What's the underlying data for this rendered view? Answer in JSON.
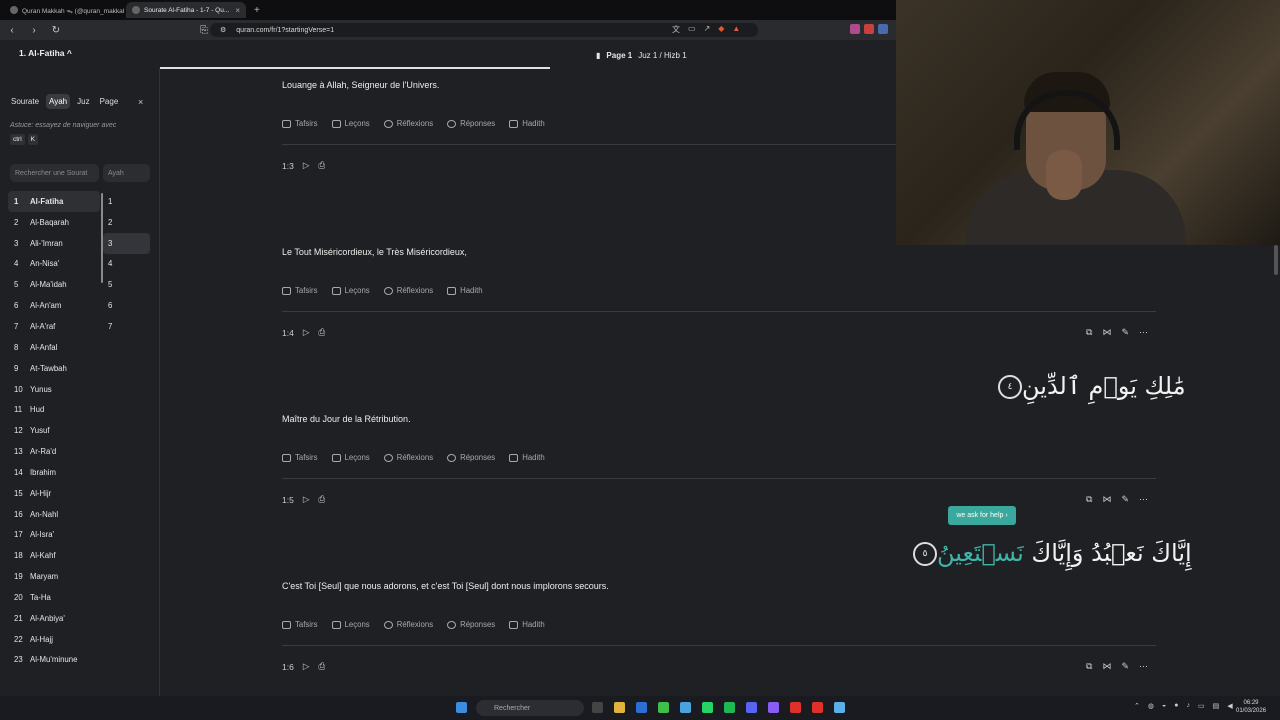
{
  "browser": {
    "tabs": [
      {
        "label": "Quran Makkah ᯓ (@quran_makkah...",
        "active": false
      },
      {
        "label": "Sourate Al-Fatiha - 1-7 - Qu...",
        "active": true
      }
    ],
    "new_tab": "+",
    "url": "quran.com/fr/1?startingVerse=1"
  },
  "header": {
    "surah_title": "1. Al-Fatiha ^",
    "page_label": "Page 1",
    "juz_label": "Juz 1 / Hizb 1"
  },
  "sidebar": {
    "tabs": [
      "Sourate",
      "Ayah",
      "Juz",
      "Page"
    ],
    "active_tab": "Ayah",
    "close": "×",
    "tip": "Astuce: essayez de naviguer avec",
    "kbd": [
      "ctrl",
      "K"
    ],
    "search_surah_placeholder": "Rechercher une Sourat",
    "search_ayah_placeholder": "Ayah",
    "surahs": [
      {
        "n": "1",
        "name": "Al-Fatiha"
      },
      {
        "n": "2",
        "name": "Al-Baqarah"
      },
      {
        "n": "3",
        "name": "Ali-'Imran"
      },
      {
        "n": "4",
        "name": "An-Nisa'"
      },
      {
        "n": "5",
        "name": "Al-Ma'idah"
      },
      {
        "n": "6",
        "name": "Al-An'am"
      },
      {
        "n": "7",
        "name": "Al-A'raf"
      },
      {
        "n": "8",
        "name": "Al-Anfal"
      },
      {
        "n": "9",
        "name": "At-Tawbah"
      },
      {
        "n": "10",
        "name": "Yunus"
      },
      {
        "n": "11",
        "name": "Hud"
      },
      {
        "n": "12",
        "name": "Yusuf"
      },
      {
        "n": "13",
        "name": "Ar-Ra'd"
      },
      {
        "n": "14",
        "name": "Ibrahim"
      },
      {
        "n": "15",
        "name": "Al-Hijr"
      },
      {
        "n": "16",
        "name": "An-Nahl"
      },
      {
        "n": "17",
        "name": "Al-Isra'"
      },
      {
        "n": "18",
        "name": "Al-Kahf"
      },
      {
        "n": "19",
        "name": "Maryam"
      },
      {
        "n": "20",
        "name": "Ta-Ha"
      },
      {
        "n": "21",
        "name": "Al-Anbiya'"
      },
      {
        "n": "22",
        "name": "Al-Hajj"
      },
      {
        "n": "23",
        "name": "Al-Mu'minune"
      }
    ],
    "ayahs": [
      "1",
      "2",
      "3",
      "4",
      "5",
      "6",
      "7"
    ]
  },
  "verses": {
    "v2_translation": "Louange à Allah, Seigneur de l'Univers.",
    "v3_key": "1:3",
    "v3_translation": "Le Tout Miséricordieux, le Très Miséricordieux,",
    "v4_key": "1:4",
    "v4_arabic": "مَٰلِكِ يَوۡمِ ٱلدِّينِ",
    "v4_mark": "٤",
    "v4_translation": "Maître du Jour de la Rétribution.",
    "v5_key": "1:5",
    "v5_arabic_main": "إِيَّاكَ نَعۡبُدُ وَإِيَّاكَ ",
    "v5_arabic_highlight": "نَسۡتَعِينُ",
    "v5_mark": "٥",
    "v5_tooltip": "we ask for help ›",
    "v5_translation": "C'est Toi [Seul] que nous adorons, et c'est Toi [Seul] dont nous implorons secours.",
    "v6_key": "1:6"
  },
  "actions": {
    "tafsirs": "Tafsirs",
    "lecons": "Leçons",
    "reflexions": "Réflexions",
    "reponses": "Réponses",
    "hadith": "Hadith"
  },
  "taskbar": {
    "search_placeholder": "Rechercher",
    "time": "06:29",
    "date": "01/03/2026"
  },
  "colors": {
    "accent": "#3fb4a9",
    "background": "#1f2023"
  }
}
